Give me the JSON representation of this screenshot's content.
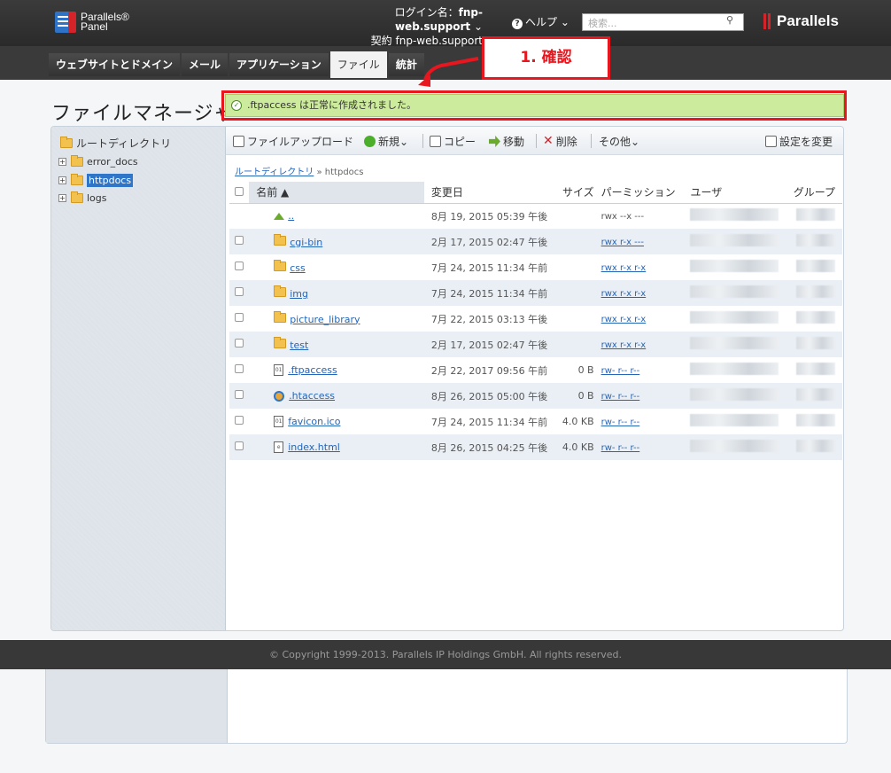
{
  "header": {
    "logo_line1": "Parallels®",
    "logo_line2": "Panel",
    "login_label": "ログイン名：",
    "login_name": "fnp-web.support",
    "contract_label": "契約",
    "contract_name": "fnp-web.support",
    "help": "ヘルプ",
    "search_placeholder": "検索...",
    "brand": "Parallels"
  },
  "nav": {
    "tabs": [
      "ウェブサイトとドメイン",
      "メール",
      "アプリケーション",
      "ファイル",
      "統計"
    ],
    "active": "ファイル"
  },
  "annotation": {
    "label": "1. 確認"
  },
  "notice": {
    "message": ".ftpaccess は正常に作成されました。"
  },
  "page": {
    "title": "ファイルマネージャ"
  },
  "sidebar": {
    "root": "ルートディレクトリ",
    "items": [
      "error_docs",
      "httpdocs",
      "logs"
    ],
    "selected": "httpdocs"
  },
  "toolbar": {
    "upload": "ファイルアップロード",
    "new": "新規",
    "copy": "コピー",
    "move": "移動",
    "delete": "削除",
    "other": "その他",
    "settings": "設定を変更"
  },
  "breadcrumb": {
    "root": "ルートディレクトリ",
    "current": "httpdocs"
  },
  "table": {
    "columns": [
      "名前",
      "変更日",
      "サイズ",
      "パーミッション",
      "ユーザ",
      "グループ"
    ],
    "rows": [
      {
        "name": "..",
        "date": "8月 19, 2015 05:39 午後",
        "size": "",
        "perm": "rwx --x ---",
        "type": "up"
      },
      {
        "name": "cgi-bin",
        "date": "2月 17, 2015 02:47 午後",
        "size": "",
        "perm": "rwx r-x ---",
        "type": "folder"
      },
      {
        "name": "css",
        "date": "7月 24, 2015 11:34 午前",
        "size": "",
        "perm": "rwx r-x r-x",
        "type": "folder"
      },
      {
        "name": "img",
        "date": "7月 24, 2015 11:34 午前",
        "size": "",
        "perm": "rwx r-x r-x",
        "type": "folder"
      },
      {
        "name": "picture_library",
        "date": "7月 22, 2015 03:13 午後",
        "size": "",
        "perm": "rwx r-x r-x",
        "type": "folder"
      },
      {
        "name": "test",
        "date": "2月 17, 2015 02:47 午後",
        "size": "",
        "perm": "rwx r-x r-x",
        "type": "folder"
      },
      {
        "name": ".ftpaccess",
        "date": "2月 22, 2017 09:56 午前",
        "size": "0 B",
        "perm": "rw- r-- r--",
        "type": "file"
      },
      {
        "name": ".htaccess",
        "date": "8月 26, 2015 05:00 午後",
        "size": "0 B",
        "perm": "rw- r-- r--",
        "type": "user"
      },
      {
        "name": "favicon.ico",
        "date": "7月 24, 2015 11:34 午前",
        "size": "4.0 KB",
        "perm": "rw- r-- r--",
        "type": "file"
      },
      {
        "name": "index.html",
        "date": "8月 26, 2015 04:25 午後",
        "size": "4.0 KB",
        "perm": "rw- r-- r--",
        "type": "file"
      }
    ]
  },
  "footer": {
    "copyright": "© Copyright 1999-2013. Parallels IP Holdings GmbH. All rights reserved."
  },
  "colors": {
    "header_bg": "#2f2f2f",
    "accent_blue": "#2f76c8",
    "highlight_red": "#e8161e",
    "notice_green": "#cdeb9c"
  }
}
